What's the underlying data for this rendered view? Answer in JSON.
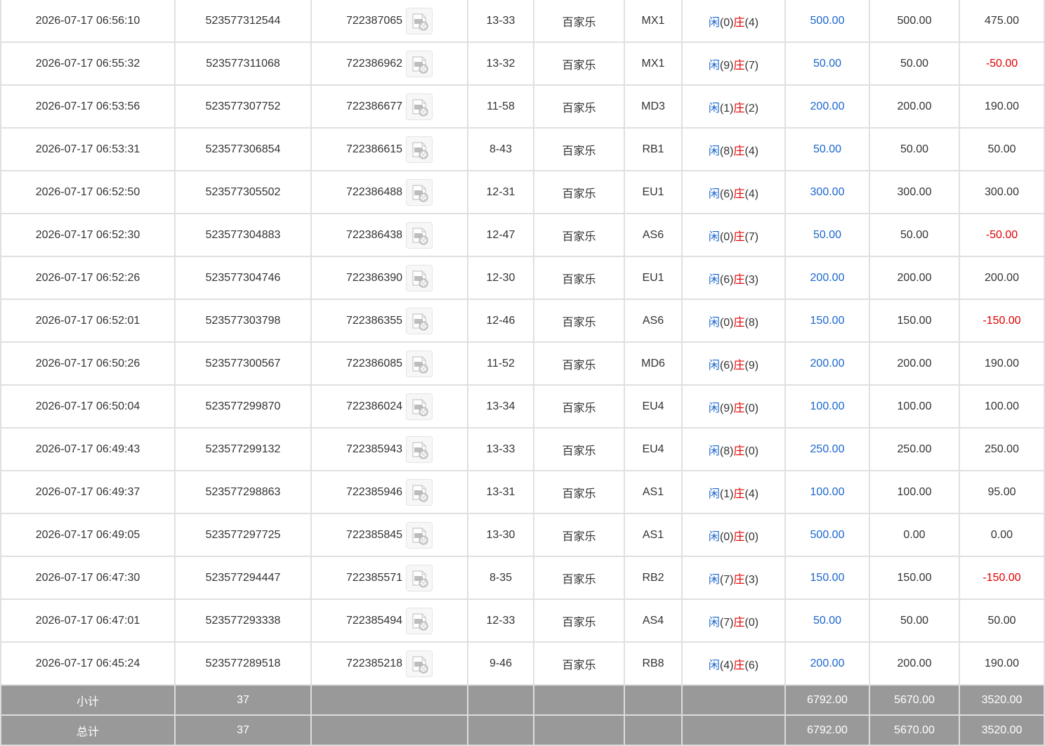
{
  "rows": [
    {
      "time": "2026-07-17 06:56:10",
      "bet_no": "523577312544",
      "round": "722387065",
      "shoe": "13-33",
      "game": "百家乐",
      "table": "MX1",
      "r1": "闲",
      "p": "(0)",
      "r2": "庄",
      "b": "(4)",
      "bet": "500.00",
      "valid": "500.00",
      "win": "475.00"
    },
    {
      "time": "2026-07-17 06:55:32",
      "bet_no": "523577311068",
      "round": "722386962",
      "shoe": "13-32",
      "game": "百家乐",
      "table": "MX1",
      "r1": "闲",
      "p": "(9)",
      "r2": "庄",
      "b": "(7)",
      "bet": "50.00",
      "valid": "50.00",
      "win": "-50.00"
    },
    {
      "time": "2026-07-17 06:53:56",
      "bet_no": "523577307752",
      "round": "722386677",
      "shoe": "11-58",
      "game": "百家乐",
      "table": "MD3",
      "r1": "闲",
      "p": "(1)",
      "r2": "庄",
      "b": "(2)",
      "bet": "200.00",
      "valid": "200.00",
      "win": "190.00"
    },
    {
      "time": "2026-07-17 06:53:31",
      "bet_no": "523577306854",
      "round": "722386615",
      "shoe": "8-43",
      "game": "百家乐",
      "table": "RB1",
      "r1": "闲",
      "p": "(8)",
      "r2": "庄",
      "b": "(4)",
      "bet": "50.00",
      "valid": "50.00",
      "win": "50.00"
    },
    {
      "time": "2026-07-17 06:52:50",
      "bet_no": "523577305502",
      "round": "722386488",
      "shoe": "12-31",
      "game": "百家乐",
      "table": "EU1",
      "r1": "闲",
      "p": "(6)",
      "r2": "庄",
      "b": "(4)",
      "bet": "300.00",
      "valid": "300.00",
      "win": "300.00"
    },
    {
      "time": "2026-07-17 06:52:30",
      "bet_no": "523577304883",
      "round": "722386438",
      "shoe": "12-47",
      "game": "百家乐",
      "table": "AS6",
      "r1": "闲",
      "p": "(0)",
      "r2": "庄",
      "b": "(7)",
      "bet": "50.00",
      "valid": "50.00",
      "win": "-50.00"
    },
    {
      "time": "2026-07-17 06:52:26",
      "bet_no": "523577304746",
      "round": "722386390",
      "shoe": "12-30",
      "game": "百家乐",
      "table": "EU1",
      "r1": "闲",
      "p": "(6)",
      "r2": "庄",
      "b": "(3)",
      "bet": "200.00",
      "valid": "200.00",
      "win": "200.00"
    },
    {
      "time": "2026-07-17 06:52:01",
      "bet_no": "523577303798",
      "round": "722386355",
      "shoe": "12-46",
      "game": "百家乐",
      "table": "AS6",
      "r1": "闲",
      "p": "(0)",
      "r2": "庄",
      "b": "(8)",
      "bet": "150.00",
      "valid": "150.00",
      "win": "-150.00"
    },
    {
      "time": "2026-07-17 06:50:26",
      "bet_no": "523577300567",
      "round": "722386085",
      "shoe": "11-52",
      "game": "百家乐",
      "table": "MD6",
      "r1": "闲",
      "p": "(6)",
      "r2": "庄",
      "b": "(9)",
      "bet": "200.00",
      "valid": "200.00",
      "win": "190.00"
    },
    {
      "time": "2026-07-17 06:50:04",
      "bet_no": "523577299870",
      "round": "722386024",
      "shoe": "13-34",
      "game": "百家乐",
      "table": "EU4",
      "r1": "闲",
      "p": "(9)",
      "r2": "庄",
      "b": "(0)",
      "bet": "100.00",
      "valid": "100.00",
      "win": "100.00"
    },
    {
      "time": "2026-07-17 06:49:43",
      "bet_no": "523577299132",
      "round": "722385943",
      "shoe": "13-33",
      "game": "百家乐",
      "table": "EU4",
      "r1": "闲",
      "p": "(8)",
      "r2": "庄",
      "b": "(0)",
      "bet": "250.00",
      "valid": "250.00",
      "win": "250.00"
    },
    {
      "time": "2026-07-17 06:49:37",
      "bet_no": "523577298863",
      "round": "722385946",
      "shoe": "13-31",
      "game": "百家乐",
      "table": "AS1",
      "r1": "闲",
      "p": "(1)",
      "r2": "庄",
      "b": "(4)",
      "bet": "100.00",
      "valid": "100.00",
      "win": "95.00"
    },
    {
      "time": "2026-07-17 06:49:05",
      "bet_no": "523577297725",
      "round": "722385845",
      "shoe": "13-30",
      "game": "百家乐",
      "table": "AS1",
      "r1": "闲",
      "p": "(0)",
      "r2": "庄",
      "b": "(0)",
      "bet": "500.00",
      "valid": "0.00",
      "win": "0.00"
    },
    {
      "time": "2026-07-17 06:47:30",
      "bet_no": "523577294447",
      "round": "722385571",
      "shoe": "8-35",
      "game": "百家乐",
      "table": "RB2",
      "r1": "闲",
      "p": "(7)",
      "r2": "庄",
      "b": "(3)",
      "bet": "150.00",
      "valid": "150.00",
      "win": "-150.00"
    },
    {
      "time": "2026-07-17 06:47:01",
      "bet_no": "523577293338",
      "round": "722385494",
      "shoe": "12-33",
      "game": "百家乐",
      "table": "AS4",
      "r1": "闲",
      "p": "(7)",
      "r2": "庄",
      "b": "(0)",
      "bet": "50.00",
      "valid": "50.00",
      "win": "50.00"
    },
    {
      "time": "2026-07-17 06:45:24",
      "bet_no": "523577289518",
      "round": "722385218",
      "shoe": "9-46",
      "game": "百家乐",
      "table": "RB8",
      "r1": "闲",
      "p": "(4)",
      "r2": "庄",
      "b": "(6)",
      "bet": "200.00",
      "valid": "200.00",
      "win": "190.00"
    }
  ],
  "subtotal": {
    "label": "小计",
    "count": "37",
    "bet": "6792.00",
    "valid": "5670.00",
    "win": "3520.00"
  },
  "total": {
    "label": "总计",
    "count": "37",
    "bet": "6792.00",
    "valid": "5670.00",
    "win": "3520.00"
  },
  "colors": {
    "player": "#1a66cc",
    "banker": "#e00000",
    "negative": "#e00000",
    "summary_bg": "#999999"
  },
  "icons": {
    "replay": "video-replay-icon"
  }
}
